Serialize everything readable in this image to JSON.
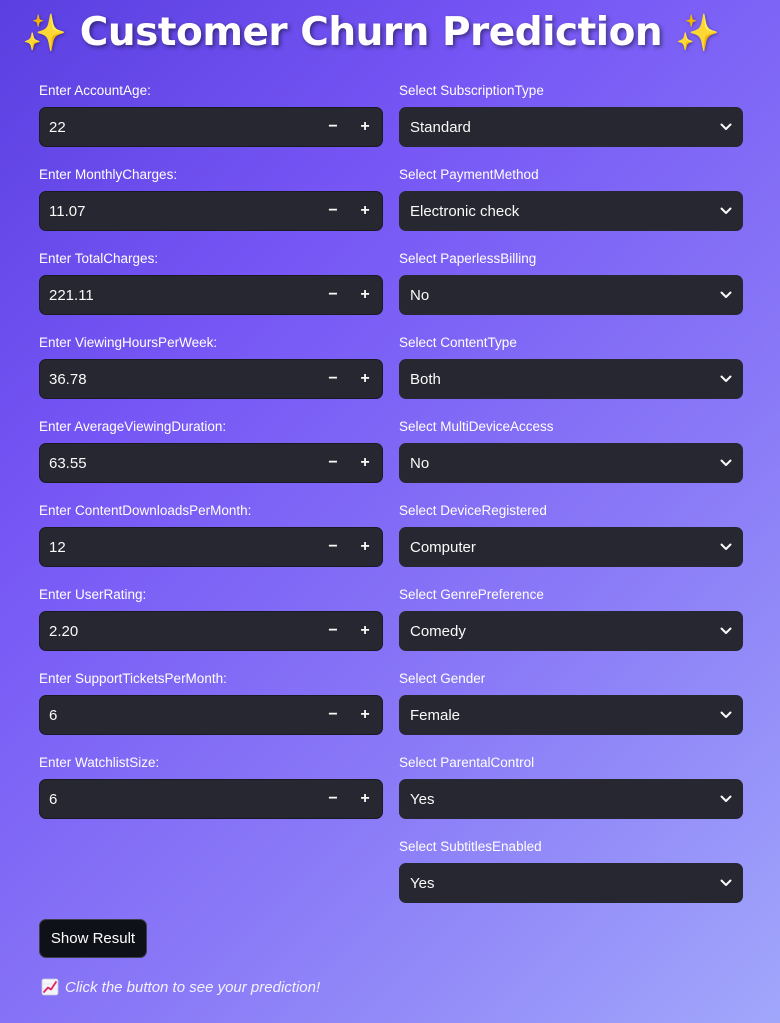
{
  "header": {
    "title": "Customer Churn Prediction",
    "sparkle": "✨"
  },
  "numeric_fields": [
    {
      "label": "Enter AccountAge:",
      "value": "22"
    },
    {
      "label": "Enter MonthlyCharges:",
      "value": "11.07"
    },
    {
      "label": "Enter TotalCharges:",
      "value": "221.11"
    },
    {
      "label": "Enter ViewingHoursPerWeek:",
      "value": "36.78"
    },
    {
      "label": "Enter AverageViewingDuration:",
      "value": "63.55"
    },
    {
      "label": "Enter ContentDownloadsPerMonth:",
      "value": "12"
    },
    {
      "label": "Enter UserRating:",
      "value": "2.20"
    },
    {
      "label": "Enter SupportTicketsPerMonth:",
      "value": "6"
    },
    {
      "label": "Enter WatchlistSize:",
      "value": "6"
    }
  ],
  "stepper": {
    "minus": "−",
    "plus": "+"
  },
  "select_fields": [
    {
      "label": "Select SubscriptionType",
      "value": "Standard"
    },
    {
      "label": "Select PaymentMethod",
      "value": "Electronic check"
    },
    {
      "label": "Select PaperlessBilling",
      "value": "No"
    },
    {
      "label": "Select ContentType",
      "value": "Both"
    },
    {
      "label": "Select MultiDeviceAccess",
      "value": "No"
    },
    {
      "label": "Select DeviceRegistered",
      "value": "Computer"
    },
    {
      "label": "Select GenrePreference",
      "value": "Comedy"
    },
    {
      "label": "Select Gender",
      "value": "Female"
    },
    {
      "label": "Select ParentalControl",
      "value": "Yes"
    },
    {
      "label": "Select SubtitlesEnabled",
      "value": "Yes"
    }
  ],
  "actions": {
    "show_result_label": "Show Result"
  },
  "hint": {
    "icon": "chart-increasing-icon",
    "text": "Click the button to see your prediction!"
  },
  "colors": {
    "input_bg": "#262730",
    "button_bg": "#0e1117",
    "sparkle": "#ffd84a"
  }
}
